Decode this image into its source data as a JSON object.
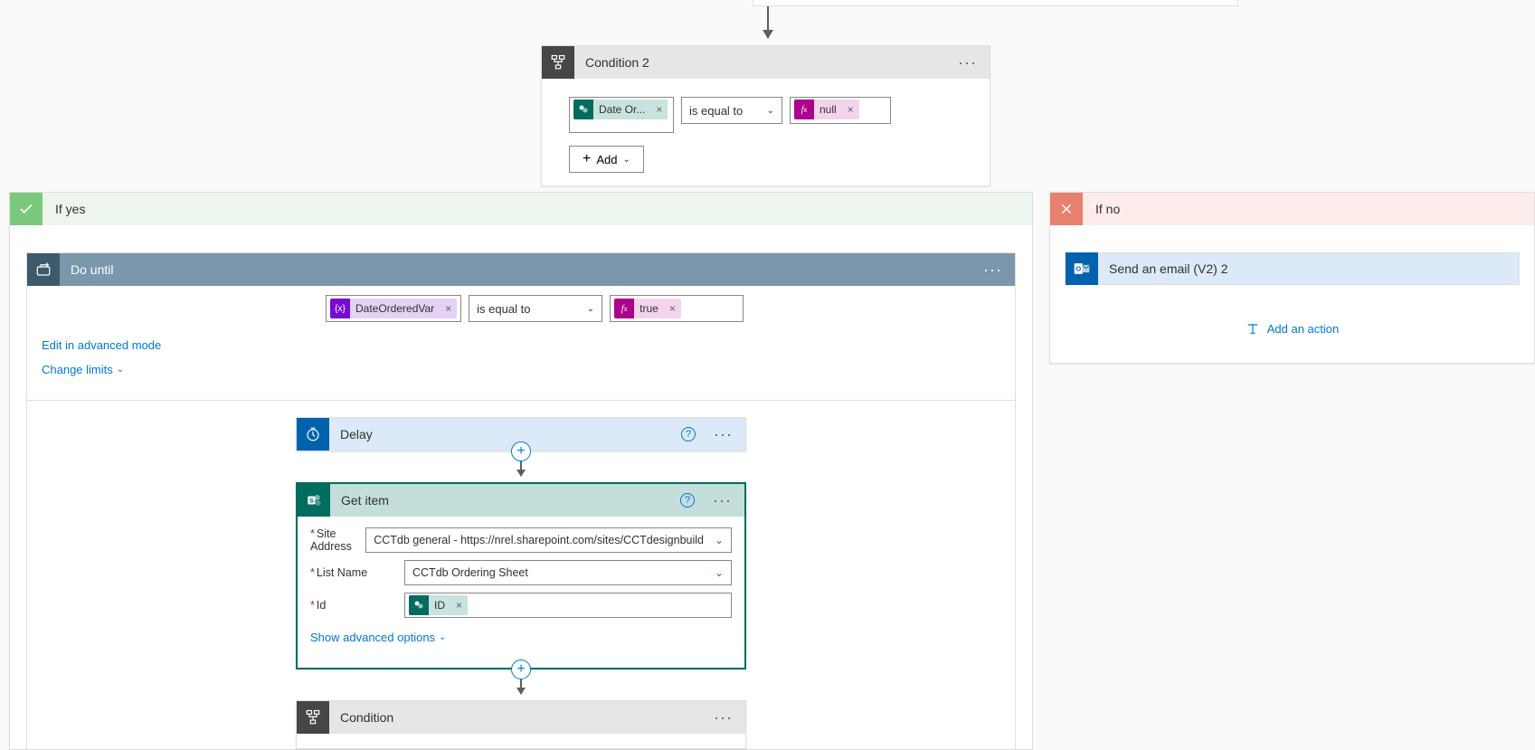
{
  "condition2": {
    "title": "Condition 2",
    "left_token_label": "Date Or...",
    "operator": "is equal to",
    "right_token_label": "null",
    "add_label": "Add"
  },
  "branch": {
    "yes_label": "If yes",
    "no_label": "If no"
  },
  "do_until": {
    "title": "Do until",
    "token_label": "DateOrderedVar",
    "operator": "is equal to",
    "value_token_label": "true",
    "edit_link": "Edit in advanced mode",
    "limits_link": "Change limits"
  },
  "delay": {
    "title": "Delay"
  },
  "get_item": {
    "title": "Get item",
    "fields": {
      "site_label": "Site Address",
      "site_value": "CCTdb general - https://nrel.sharepoint.com/sites/CCTdesignbuild",
      "list_label": "List Name",
      "list_value": "CCTdb Ordering Sheet",
      "id_label": "Id",
      "id_token": "ID"
    },
    "advanced_link": "Show advanced options"
  },
  "condition_inner": {
    "title": "Condition"
  },
  "if_no": {
    "send_email_label": "Send an email (V2) 2",
    "add_action_label": "Add an action"
  }
}
